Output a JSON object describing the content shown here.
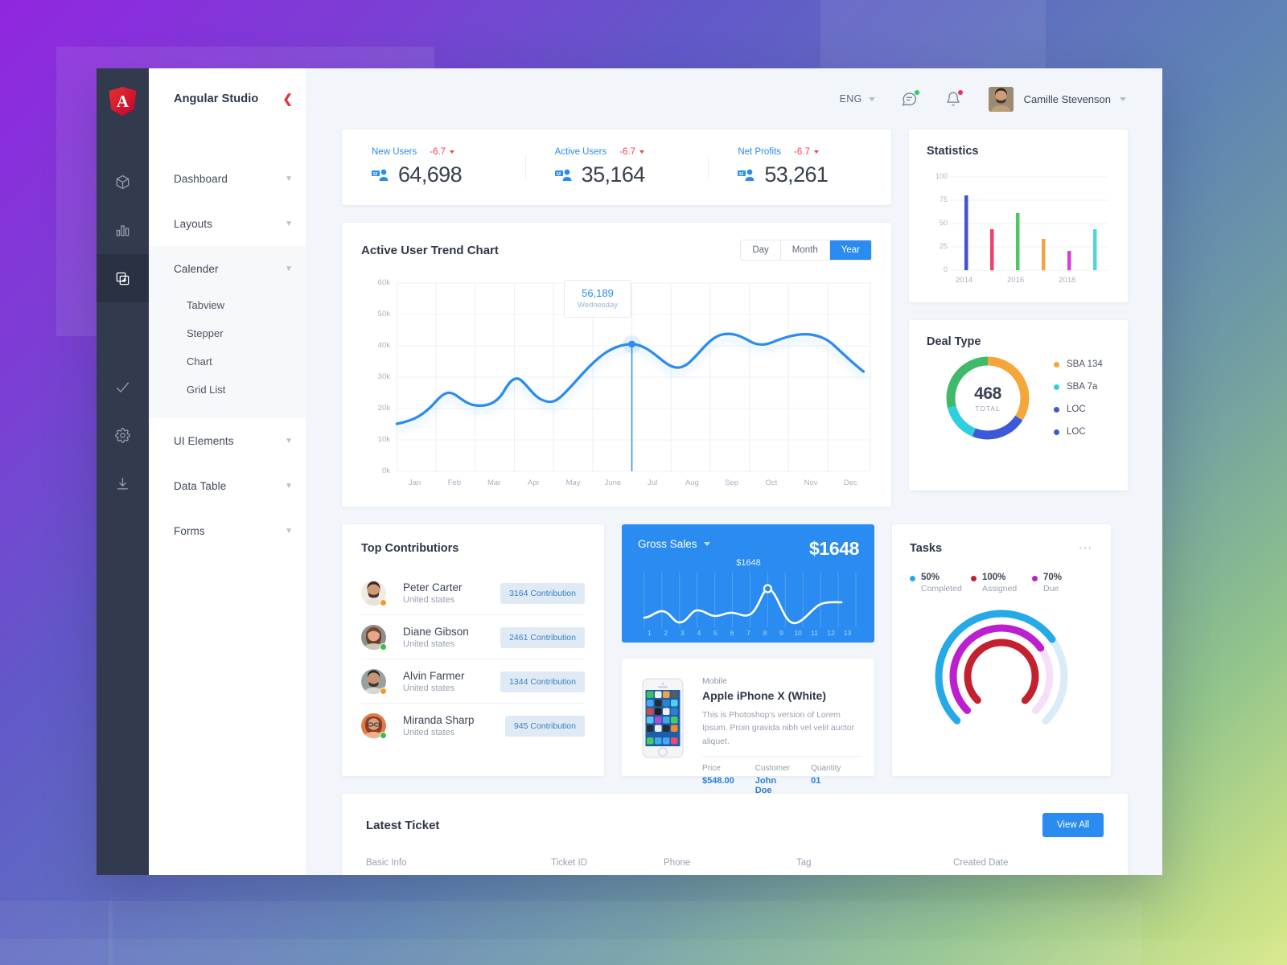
{
  "brand": {
    "title": "Angular Studio",
    "collapse_icon": "chevron-left-icon"
  },
  "rail": {
    "logo": "angular-logo",
    "items": [
      {
        "name": "cube-icon",
        "active": false
      },
      {
        "name": "bar-chart-icon",
        "active": false
      },
      {
        "name": "copy-add-icon",
        "active": true
      },
      {
        "name": "check-icon",
        "active": false
      },
      {
        "name": "gear-icon",
        "active": false
      },
      {
        "name": "download-icon",
        "active": false
      }
    ]
  },
  "sidebar": {
    "groups": [
      {
        "label": "Dashboard",
        "expanded": false
      },
      {
        "label": "Layouts",
        "expanded": false
      },
      {
        "label": "Calender",
        "expanded": true,
        "children": [
          "Tabview",
          "Stepper",
          "Chart",
          "Grid List"
        ]
      },
      {
        "label": "UI Elements",
        "expanded": false
      },
      {
        "label": "Data Table",
        "expanded": false
      },
      {
        "label": "Forms",
        "expanded": false
      }
    ]
  },
  "topbar": {
    "language": "ENG",
    "message_icon": "message-icon",
    "bell_icon": "bell-icon",
    "message_badge": true,
    "bell_badge": true,
    "user_name": "Camille Stevenson"
  },
  "kpis": [
    {
      "label": "New Users",
      "delta": "-6.7",
      "value": "64,698"
    },
    {
      "label": "Active Users",
      "delta": "-6.7",
      "value": "35,164"
    },
    {
      "label": "Net Profits",
      "delta": "-6.7",
      "value": "53,261"
    }
  ],
  "trend": {
    "title": "Active User Trend Chart",
    "ranges": [
      {
        "label": "Day",
        "active": false
      },
      {
        "label": "Month",
        "active": false
      },
      {
        "label": "Year",
        "active": true
      }
    ],
    "tooltip": {
      "value": "56,189",
      "sub": "Wednesday"
    }
  },
  "statistics": {
    "title": "Statistics"
  },
  "deal": {
    "title": "Deal Type",
    "total": "468",
    "total_label": "TOTAL",
    "legend": [
      {
        "label": "SBA 134",
        "color": "#f5a63b"
      },
      {
        "label": "SBA 7a",
        "color": "#2ed0e0"
      },
      {
        "label": "LOC",
        "color": "#3d58d8"
      },
      {
        "label": "LOC",
        "color": "#3d58d8"
      }
    ]
  },
  "contributors": {
    "title": "Top Contributiors",
    "rows": [
      {
        "name": "Peter Carter",
        "country": "United states",
        "badge": "3164 Contribution",
        "status": "#f5992b",
        "skin": "#cf9a75",
        "hair": "#3a2a20"
      },
      {
        "name": "Diane Gibson",
        "country": "United states",
        "badge": "2461 Contribution",
        "status": "#34c241",
        "skin": "#e0a98b",
        "hair": "#6b3a22"
      },
      {
        "name": "Alvin Farmer",
        "country": "United states",
        "badge": "1344 Contribution",
        "status": "#f5992b",
        "skin": "#c89574",
        "hair": "#2e2520"
      },
      {
        "name": "Miranda Sharp",
        "country": "United states",
        "badge": "945 Contribution",
        "status": "#34c241",
        "skin": "#d9a07c",
        "hair": "#8a3b22"
      }
    ]
  },
  "sales": {
    "label": "Gross Sales",
    "amount": "$1648",
    "point_label": "$1648",
    "xticks": [
      "1",
      "2",
      "3",
      "4",
      "5",
      "6",
      "7",
      "8",
      "9",
      "10",
      "11",
      "12",
      "13"
    ]
  },
  "product": {
    "category": "Mobile",
    "name": "Apple iPhone X (White)",
    "description": "This is Photoshop's version  of Lorem Ipsum. Proin gravida nibh vel velit auctor aliquet.",
    "meta": [
      {
        "key": "Price",
        "value": "$548.00"
      },
      {
        "key": "Customer",
        "value": "John Doe"
      },
      {
        "key": "Quantity",
        "value": "01"
      }
    ]
  },
  "tasks": {
    "title": "Tasks",
    "menu_icon": "more-horizontal-icon",
    "legend": [
      {
        "pct": "50%",
        "label": "Completed",
        "color": "#25a9e8"
      },
      {
        "pct": "100%",
        "label": "Assigned",
        "color": "#c4202e"
      },
      {
        "pct": "70%",
        "label": "Due",
        "color": "#bb1fd0"
      }
    ]
  },
  "ticket": {
    "title": "Latest Ticket",
    "view_all": "View All",
    "columns": [
      "Basic Info",
      "Ticket ID",
      "Phone",
      "Tag",
      "Created Date"
    ]
  },
  "chart_data": [
    {
      "type": "line",
      "title": "Active User Trend Chart",
      "xlabel": "",
      "ylabel": "",
      "categories": [
        "Jan",
        "Feb",
        "Mar",
        "Apr",
        "May",
        "June",
        "Jul",
        "Aug",
        "Sep",
        "Oct",
        "Nov",
        "Dec"
      ],
      "yticks": [
        "0k",
        "10k",
        "20k",
        "30k",
        "40k",
        "50k",
        "60k"
      ],
      "ylim": [
        0,
        60000
      ],
      "grid": true,
      "legend": "none",
      "series": [
        {
          "name": "Active Users",
          "values": [
            15000,
            22300,
            20800,
            28300,
            23800,
            33000,
            42700,
            37200,
            47200,
            44800,
            47200,
            41800
          ]
        }
      ],
      "annotation": {
        "x": "Jul",
        "value": "56,189",
        "sub": "Wednesday"
      }
    },
    {
      "type": "bar",
      "title": "Statistics",
      "categories": [
        "2014",
        "",
        "2016",
        "",
        "2018",
        ""
      ],
      "xticks": [
        "2014",
        "2016",
        "2018"
      ],
      "values": [
        79,
        44,
        61,
        34,
        21,
        44
      ],
      "colors": [
        "#4053d6",
        "#ef4264",
        "#4cc85f",
        "#f0a543",
        "#d640d8",
        "#4fd8da"
      ],
      "ylim": [
        0,
        100
      ],
      "yticks": [
        "0",
        "25",
        "50",
        "75",
        "100"
      ],
      "grid": true
    },
    {
      "type": "pie",
      "title": "Deal Type",
      "center_value": "468",
      "center_label": "TOTAL",
      "labels": [
        "SBA 134",
        "SBA 7a",
        "LOC",
        "LOC"
      ],
      "values": [
        34,
        15,
        22,
        29
      ],
      "colors": [
        "#f5a63b",
        "#2ed0e0",
        "#3d58d8",
        "#3fb96a"
      ]
    },
    {
      "type": "line",
      "title": "Gross Sales",
      "x": [
        "1",
        "2",
        "3",
        "4",
        "5",
        "6",
        "7",
        "8",
        "9",
        "10",
        "11",
        "12",
        "13"
      ],
      "values": [
        18,
        26,
        10,
        14,
        27,
        24,
        22,
        68,
        42,
        6,
        20,
        44,
        46
      ],
      "annotation": {
        "x": "8",
        "value": "$1648"
      },
      "grid": true
    },
    {
      "type": "pie",
      "title": "Tasks",
      "labels": [
        "Completed",
        "Assigned",
        "Due"
      ],
      "values": [
        50,
        100,
        70
      ],
      "colors": [
        "#25a9e8",
        "#c4202e",
        "#bb1fd0"
      ]
    }
  ]
}
